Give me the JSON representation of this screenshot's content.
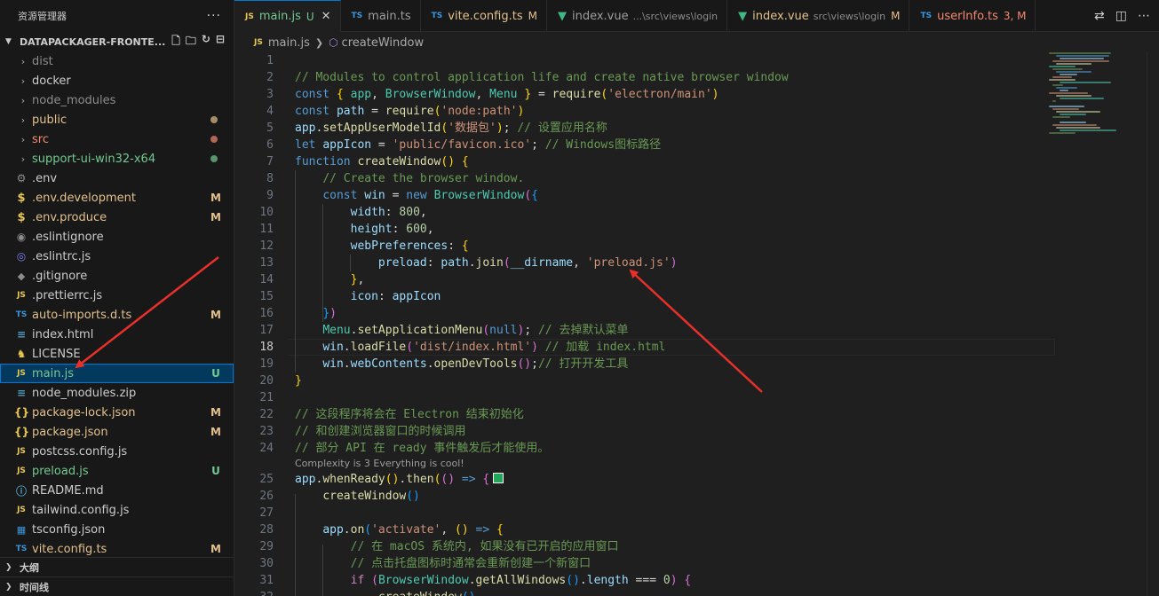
{
  "explorer": {
    "title": "资源管理器",
    "more_label": "···",
    "root_folder": "DATAPACKAGER-FRONTE...",
    "items": [
      {
        "type": "folder",
        "label": "dist",
        "status": "",
        "color": "dim"
      },
      {
        "type": "folder",
        "label": "docker",
        "status": "",
        "color": ""
      },
      {
        "type": "folder",
        "label": "node_modules",
        "status": "",
        "color": "dim"
      },
      {
        "type": "folder",
        "label": "public",
        "status": "dot-mod",
        "color": "mod"
      },
      {
        "type": "folder",
        "label": "src",
        "status": "dot-err",
        "color": "err"
      },
      {
        "type": "folder",
        "label": "support-ui-win32-x64",
        "status": "dot-untr",
        "color": "untr"
      },
      {
        "type": "file",
        "icon": "gear",
        "label": ".env",
        "status": "",
        "color": ""
      },
      {
        "type": "file",
        "icon": "dollar",
        "label": ".env.development",
        "status": "M",
        "color": "mod"
      },
      {
        "type": "file",
        "icon": "dollar",
        "label": ".env.produce",
        "status": "M",
        "color": "mod"
      },
      {
        "type": "file",
        "icon": "circ",
        "label": ".eslintignore",
        "status": "",
        "color": ""
      },
      {
        "type": "file",
        "icon": "eslint",
        "label": ".eslintrc.js",
        "status": "",
        "color": ""
      },
      {
        "type": "file",
        "icon": "diamond",
        "label": ".gitignore",
        "status": "",
        "color": ""
      },
      {
        "type": "file",
        "icon": "js",
        "label": ".prettierrc.js",
        "status": "",
        "color": ""
      },
      {
        "type": "file",
        "icon": "ts",
        "label": "auto-imports.d.ts",
        "status": "M",
        "color": "mod"
      },
      {
        "type": "file",
        "icon": "lines",
        "label": "index.html",
        "status": "",
        "color": ""
      },
      {
        "type": "file",
        "icon": "lic",
        "label": "LICENSE",
        "status": "",
        "color": ""
      },
      {
        "type": "file",
        "icon": "js",
        "label": "main.js",
        "status": "U",
        "color": "untr",
        "selected": true
      },
      {
        "type": "file",
        "icon": "lines",
        "label": "node_modules.zip",
        "status": "",
        "color": ""
      },
      {
        "type": "file",
        "icon": "brace",
        "label": "package-lock.json",
        "status": "M",
        "color": "mod"
      },
      {
        "type": "file",
        "icon": "brace",
        "label": "package.json",
        "status": "M",
        "color": "mod"
      },
      {
        "type": "file",
        "icon": "js",
        "label": "postcss.config.js",
        "status": "",
        "color": ""
      },
      {
        "type": "file",
        "icon": "js",
        "label": "preload.js",
        "status": "U",
        "color": "untr"
      },
      {
        "type": "file",
        "icon": "info",
        "label": "README.md",
        "status": "",
        "color": ""
      },
      {
        "type": "file",
        "icon": "js",
        "label": "tailwind.config.js",
        "status": "",
        "color": ""
      },
      {
        "type": "file",
        "icon": "tsconf",
        "label": "tsconfig.json",
        "status": "",
        "color": ""
      },
      {
        "type": "file",
        "icon": "ts",
        "label": "vite.config.ts",
        "status": "M",
        "color": "mod"
      }
    ],
    "outline_label": "大纲",
    "timeline_label": "时间线"
  },
  "icon_text": {
    "js": "JS",
    "ts": "TS",
    "dollar": "$",
    "brace": "{}",
    "gear": "⚙",
    "circ": "◉",
    "eslint": "◎",
    "diamond": "◆",
    "lines": "≡",
    "lic": "♞",
    "info": "ⓘ",
    "tsconf": "▦"
  },
  "tabs": [
    {
      "icon": "js",
      "label": "main.js",
      "desc": "",
      "badge": "U",
      "badge_color": "untr",
      "color": "untr",
      "active": true
    },
    {
      "icon": "ts",
      "label": "main.ts",
      "desc": "",
      "badge": "",
      "badge_color": "",
      "color": "",
      "active": false
    },
    {
      "icon": "ts",
      "label": "vite.config.ts",
      "desc": "",
      "badge": "M",
      "badge_color": "mod",
      "color": "mod",
      "active": false
    },
    {
      "icon": "vue",
      "label": "index.vue",
      "desc": "...\\src\\views\\login",
      "badge": "",
      "badge_color": "",
      "color": "",
      "active": false
    },
    {
      "icon": "vue",
      "label": "index.vue",
      "desc": "src\\views\\login",
      "badge": "M",
      "badge_color": "mod",
      "color": "mod",
      "active": false
    },
    {
      "icon": "ts",
      "label": "userInfo.ts",
      "desc": "",
      "badge": "3, M",
      "badge_color": "err",
      "color": "err",
      "active": false
    }
  ],
  "breadcrumb": {
    "file": "main.js",
    "symbol": "createWindow"
  },
  "editor": {
    "current_line": 18,
    "codelens": "Complexity is 3 Everything is cool!",
    "lines": [
      {
        "n": 1,
        "t": []
      },
      {
        "n": 2,
        "t": [
          [
            "com",
            "// Modules to control application life and create native browser window"
          ]
        ]
      },
      {
        "n": 3,
        "t": [
          [
            "kw",
            "const"
          ],
          [
            "pl",
            " "
          ],
          [
            "p1",
            "{"
          ],
          [
            "pl",
            " "
          ],
          [
            "cls",
            "app"
          ],
          [
            "pl",
            ", "
          ],
          [
            "cls",
            "BrowserWindow"
          ],
          [
            "pl",
            ", "
          ],
          [
            "cls",
            "Menu"
          ],
          [
            "pl",
            " "
          ],
          [
            "p1",
            "}"
          ],
          [
            "pl",
            " = "
          ],
          [
            "fn",
            "require"
          ],
          [
            "p1",
            "("
          ],
          [
            "str",
            "'electron/main'"
          ],
          [
            "p1",
            ")"
          ]
        ]
      },
      {
        "n": 4,
        "t": [
          [
            "kw",
            "const"
          ],
          [
            "pl",
            " "
          ],
          [
            "var",
            "path"
          ],
          [
            "pl",
            " = "
          ],
          [
            "fn",
            "require"
          ],
          [
            "p1",
            "("
          ],
          [
            "str",
            "'node:path'"
          ],
          [
            "p1",
            ")"
          ]
        ]
      },
      {
        "n": 5,
        "t": [
          [
            "var",
            "app"
          ],
          [
            "pl",
            "."
          ],
          [
            "fn",
            "setAppUserModelId"
          ],
          [
            "p1",
            "("
          ],
          [
            "str",
            "'数据包'"
          ],
          [
            "p1",
            ")"
          ],
          [
            "pl",
            "; "
          ],
          [
            "com",
            "// 设置应用名称"
          ]
        ]
      },
      {
        "n": 6,
        "t": [
          [
            "kw",
            "let"
          ],
          [
            "pl",
            " "
          ],
          [
            "var",
            "appIcon"
          ],
          [
            "pl",
            " = "
          ],
          [
            "str",
            "'public/favicon.ico'"
          ],
          [
            "pl",
            "; "
          ],
          [
            "com",
            "// Windows图标路径"
          ]
        ]
      },
      {
        "n": 7,
        "t": [
          [
            "kw",
            "function"
          ],
          [
            "pl",
            " "
          ],
          [
            "fn",
            "createWindow"
          ],
          [
            "p1",
            "()"
          ],
          [
            "pl",
            " "
          ],
          [
            "p1",
            "{"
          ]
        ]
      },
      {
        "n": 8,
        "t": [
          [
            "pl",
            "    "
          ],
          [
            "com",
            "// Create the browser window."
          ]
        ]
      },
      {
        "n": 9,
        "t": [
          [
            "pl",
            "    "
          ],
          [
            "kw",
            "const"
          ],
          [
            "pl",
            " "
          ],
          [
            "var",
            "win"
          ],
          [
            "pl",
            " = "
          ],
          [
            "kw",
            "new"
          ],
          [
            "pl",
            " "
          ],
          [
            "cls",
            "BrowserWindow"
          ],
          [
            "p2",
            "("
          ],
          [
            "p3",
            "{"
          ]
        ]
      },
      {
        "n": 10,
        "t": [
          [
            "pl",
            "        "
          ],
          [
            "var",
            "width"
          ],
          [
            "pl",
            ": "
          ],
          [
            "num",
            "800"
          ],
          [
            "pl",
            ","
          ]
        ]
      },
      {
        "n": 11,
        "t": [
          [
            "pl",
            "        "
          ],
          [
            "var",
            "height"
          ],
          [
            "pl",
            ": "
          ],
          [
            "num",
            "600"
          ],
          [
            "pl",
            ","
          ]
        ]
      },
      {
        "n": 12,
        "t": [
          [
            "pl",
            "        "
          ],
          [
            "var",
            "webPreferences"
          ],
          [
            "pl",
            ": "
          ],
          [
            "p1",
            "{"
          ]
        ]
      },
      {
        "n": 13,
        "t": [
          [
            "pl",
            "            "
          ],
          [
            "var",
            "preload"
          ],
          [
            "pl",
            ": "
          ],
          [
            "var",
            "path"
          ],
          [
            "pl",
            "."
          ],
          [
            "fn",
            "join"
          ],
          [
            "p2",
            "("
          ],
          [
            "var",
            "__dirname"
          ],
          [
            "pl",
            ", "
          ],
          [
            "str",
            "'preload.js'"
          ],
          [
            "p2",
            ")"
          ]
        ]
      },
      {
        "n": 14,
        "t": [
          [
            "pl",
            "        "
          ],
          [
            "p1",
            "}"
          ],
          [
            "pl",
            ","
          ]
        ]
      },
      {
        "n": 15,
        "t": [
          [
            "pl",
            "        "
          ],
          [
            "var",
            "icon"
          ],
          [
            "pl",
            ": "
          ],
          [
            "var",
            "appIcon"
          ]
        ]
      },
      {
        "n": 16,
        "t": [
          [
            "pl",
            "    "
          ],
          [
            "p3",
            "}"
          ],
          [
            "p2",
            ")"
          ]
        ]
      },
      {
        "n": 17,
        "t": [
          [
            "pl",
            "    "
          ],
          [
            "cls",
            "Menu"
          ],
          [
            "pl",
            "."
          ],
          [
            "fn",
            "setApplicationMenu"
          ],
          [
            "p2",
            "("
          ],
          [
            "kw",
            "null"
          ],
          [
            "p2",
            ")"
          ],
          [
            "pl",
            "; "
          ],
          [
            "com",
            "// 去掉默认菜单"
          ]
        ]
      },
      {
        "n": 18,
        "t": [
          [
            "pl",
            "    "
          ],
          [
            "var",
            "win"
          ],
          [
            "pl",
            "."
          ],
          [
            "fn",
            "loadFile"
          ],
          [
            "p2",
            "("
          ],
          [
            "str",
            "'dist/index.html'"
          ],
          [
            "p2",
            ")"
          ],
          [
            "pl",
            " "
          ],
          [
            "com",
            "// 加载 index.html"
          ]
        ]
      },
      {
        "n": 19,
        "t": [
          [
            "pl",
            "    "
          ],
          [
            "var",
            "win"
          ],
          [
            "pl",
            "."
          ],
          [
            "var",
            "webContents"
          ],
          [
            "pl",
            "."
          ],
          [
            "fn",
            "openDevTools"
          ],
          [
            "p2",
            "()"
          ],
          [
            "pl",
            ";"
          ],
          [
            "com",
            "// 打开开发工具"
          ]
        ]
      },
      {
        "n": 20,
        "t": [
          [
            "p1",
            "}"
          ]
        ]
      },
      {
        "n": 21,
        "t": []
      },
      {
        "n": 22,
        "t": [
          [
            "com",
            "// 这段程序将会在 Electron 结束初始化"
          ]
        ]
      },
      {
        "n": 23,
        "t": [
          [
            "com",
            "// 和创建浏览器窗口的时候调用"
          ]
        ]
      },
      {
        "n": 24,
        "t": [
          [
            "com",
            "// 部分 API 在 ready 事件触发后才能使用。"
          ]
        ],
        "lens_after": true
      },
      {
        "n": 25,
        "t": [
          [
            "var",
            "app"
          ],
          [
            "pl",
            "."
          ],
          [
            "fn",
            "whenReady"
          ],
          [
            "p1",
            "()"
          ],
          [
            "pl",
            "."
          ],
          [
            "fn",
            "then"
          ],
          [
            "p1",
            "("
          ],
          [
            "p2",
            "()"
          ],
          [
            "pl",
            " "
          ],
          [
            "kw",
            "=>"
          ],
          [
            "pl",
            " "
          ],
          [
            "p2",
            "{"
          ]
        ],
        "square": true
      },
      {
        "n": 26,
        "t": [
          [
            "pl",
            "    "
          ],
          [
            "fn",
            "createWindow"
          ],
          [
            "p3",
            "()"
          ]
        ]
      },
      {
        "n": 27,
        "t": []
      },
      {
        "n": 28,
        "t": [
          [
            "pl",
            "    "
          ],
          [
            "var",
            "app"
          ],
          [
            "pl",
            "."
          ],
          [
            "fn",
            "on"
          ],
          [
            "p3",
            "("
          ],
          [
            "str",
            "'activate'"
          ],
          [
            "pl",
            ", "
          ],
          [
            "p1",
            "()"
          ],
          [
            "pl",
            " "
          ],
          [
            "kw",
            "=>"
          ],
          [
            "pl",
            " "
          ],
          [
            "p1",
            "{"
          ]
        ]
      },
      {
        "n": 29,
        "t": [
          [
            "pl",
            "        "
          ],
          [
            "com",
            "// 在 macOS 系统内, 如果没有已开启的应用窗口"
          ]
        ]
      },
      {
        "n": 30,
        "t": [
          [
            "pl",
            "        "
          ],
          [
            "com",
            "// 点击托盘图标时通常会重新创建一个新窗口"
          ]
        ]
      },
      {
        "n": 31,
        "t": [
          [
            "pl",
            "        "
          ],
          [
            "ctl",
            "if"
          ],
          [
            "pl",
            " "
          ],
          [
            "p2",
            "("
          ],
          [
            "cls",
            "BrowserWindow"
          ],
          [
            "pl",
            "."
          ],
          [
            "fn",
            "getAllWindows"
          ],
          [
            "p3",
            "()"
          ],
          [
            "pl",
            "."
          ],
          [
            "var",
            "length"
          ],
          [
            "pl",
            " === "
          ],
          [
            "num",
            "0"
          ],
          [
            "p2",
            ")"
          ],
          [
            "pl",
            " "
          ],
          [
            "p2",
            "{"
          ]
        ]
      },
      {
        "n": 32,
        "t": [
          [
            "pl",
            "            "
          ],
          [
            "fn",
            "createWindow"
          ],
          [
            "p3",
            "()"
          ]
        ]
      }
    ]
  },
  "colors": {
    "accent": "#0078d4",
    "modified": "#e2c08d",
    "untracked": "#73c991",
    "error": "#f48771",
    "annotation_arrow": "#e8302a"
  }
}
